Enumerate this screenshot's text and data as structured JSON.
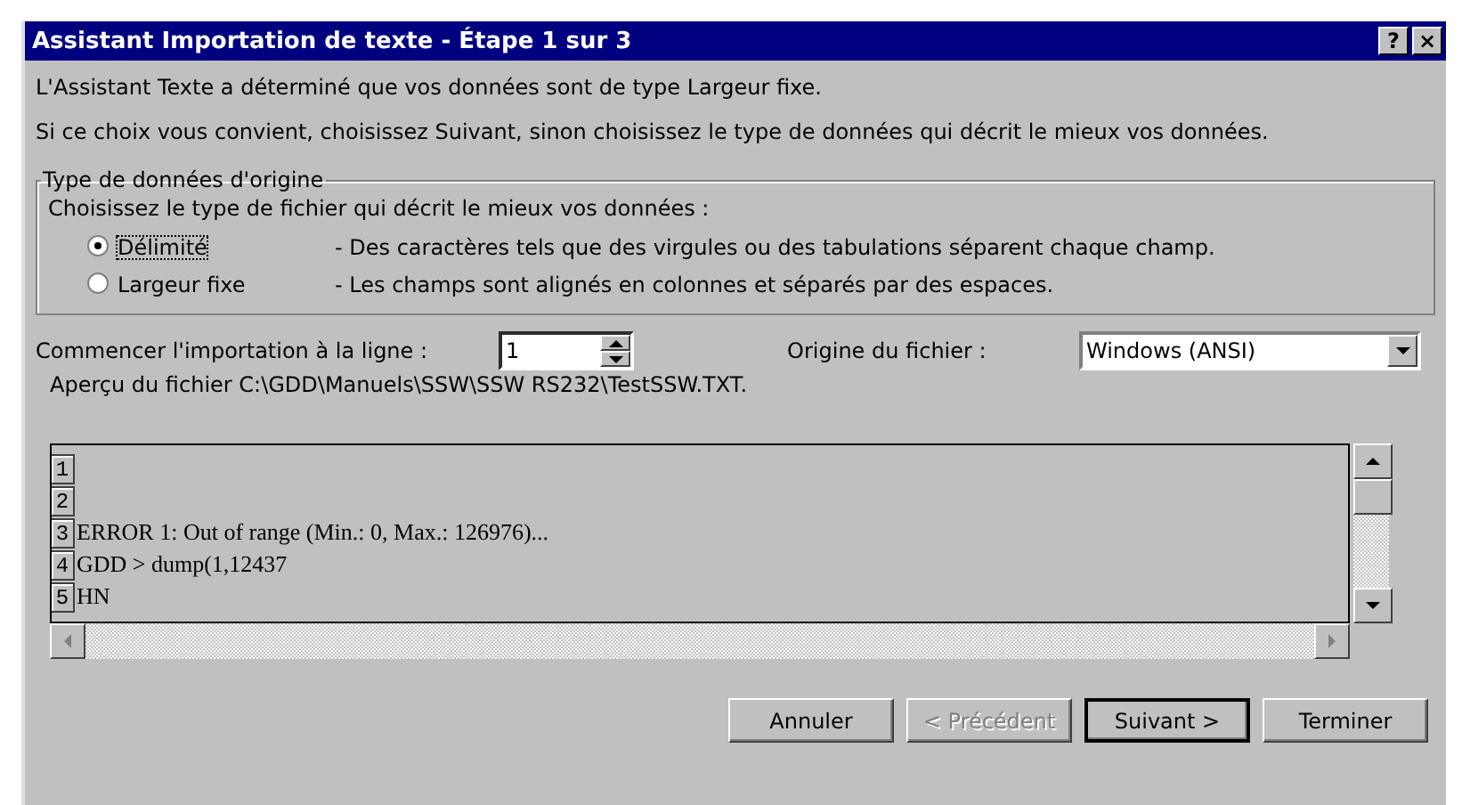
{
  "window": {
    "title": "Assistant Importation de texte - Étape 1 sur 3",
    "title_buttons": [
      "?",
      "×"
    ]
  },
  "intro": [
    "L'Assistant Texte a déterminé que vos données sont de type Largeur fixe.",
    "Si ce choix vous convient, choisissez Suivant, sinon choisissez le type de données qui décrit le mieux vos données."
  ],
  "data_type": {
    "legend": "Type de données d'origine",
    "prompt": "Choisissez le type de fichier qui décrit le mieux vos données :",
    "options": [
      {
        "label": "Délimité",
        "description": "- Des caractères tels que des virgules ou des tabulations séparent chaque champ.",
        "selected": true
      },
      {
        "label": "Largeur fixe",
        "description": "- Les champs sont alignés en colonnes et séparés par des espaces.",
        "selected": false
      }
    ]
  },
  "start_row": {
    "label": "Commencer l'importation à la ligne :",
    "value": "1"
  },
  "file_origin": {
    "label": "Origine du fichier :",
    "value": "Windows (ANSI)"
  },
  "preview": {
    "label": "Aperçu du fichier C:\\GDD\\Manuels\\SSW\\SSW RS232\\TestSSW.TXT.",
    "lines": [
      {
        "number": "1"
      },
      {
        "number": "2"
      },
      {
        "number": "3",
        "text": "ERROR 1: Out of range (Min.: 0, Max.: 126976)..."
      },
      {
        "number": "4",
        "text": "GDD > dump(1,12437"
      },
      {
        "number": "5",
        "text": "HN"
      }
    ]
  },
  "buttons": [
    {
      "label": "Annuler",
      "disabled": false,
      "default": false
    },
    {
      "label": "< Précédent",
      "disabled": true,
      "default": false
    },
    {
      "label": "Suivant >",
      "disabled": false,
      "default": true
    },
    {
      "label": "Terminer",
      "disabled": false,
      "default": false
    }
  ]
}
